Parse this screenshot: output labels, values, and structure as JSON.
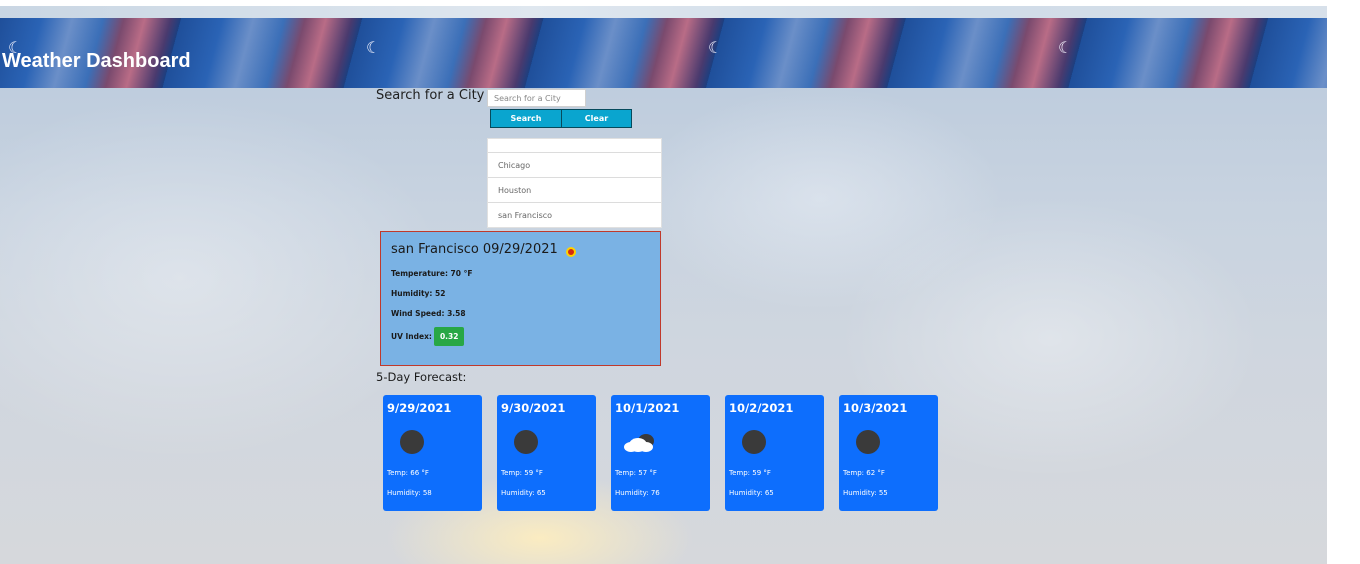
{
  "header": {
    "title": "Weather Dashboard"
  },
  "search": {
    "label": "Search for a City",
    "placeholder": "Search for a City",
    "search_button": "Search",
    "clear_button": "Clear"
  },
  "history": [
    "Chicago",
    "Houston",
    "san Francisco"
  ],
  "current": {
    "city": "san Francisco",
    "date": "09/29/2021",
    "icon": "clear-night-icon",
    "temperature": "Temperature: 70 °F",
    "humidity": "Humidity: 52",
    "wind": "Wind Speed: 3.58",
    "uv_label": "UV Index:",
    "uv_value": "0.32",
    "uv_color": "#28a745"
  },
  "forecast": {
    "label": "5-Day Forecast:",
    "days": [
      {
        "date": "9/29/2021",
        "icon": "moon-icon",
        "temp": "Temp: 66 °F",
        "humidity": "Humidity: 58"
      },
      {
        "date": "9/30/2021",
        "icon": "moon-icon",
        "temp": "Temp: 59 °F",
        "humidity": "Humidity: 65"
      },
      {
        "date": "10/1/2021",
        "icon": "cloud-icon",
        "temp": "Temp: 57 °F",
        "humidity": "Humidity: 76"
      },
      {
        "date": "10/2/2021",
        "icon": "moon-icon",
        "temp": "Temp: 59 °F",
        "humidity": "Humidity: 65"
      },
      {
        "date": "10/3/2021",
        "icon": "moon-icon",
        "temp": "Temp: 62 °F",
        "humidity": "Humidity: 55"
      }
    ]
  },
  "colors": {
    "card": "#0d6efd",
    "button": "#0aa5cf",
    "current_panel": "#7ab2e4"
  }
}
